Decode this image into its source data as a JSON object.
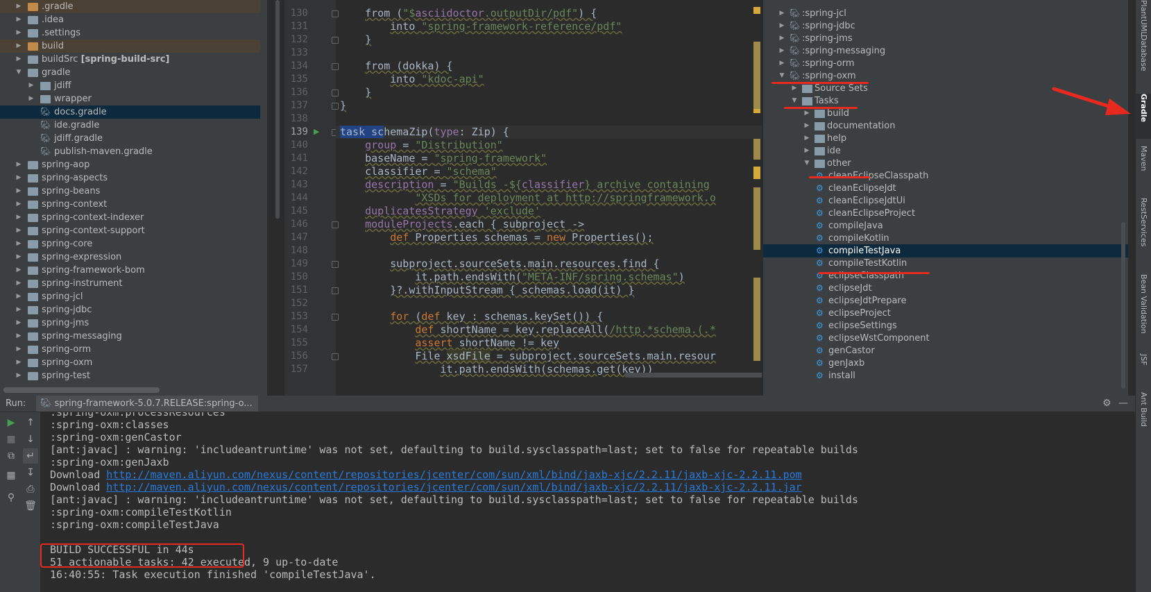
{
  "project_tree": [
    {
      "label": "gradle-dot",
      "text": ".gradle",
      "indent": 0,
      "expanded": false,
      "icon": "folder",
      "orange": true,
      "hl": true
    },
    {
      "text": ".idea",
      "indent": 0,
      "expanded": false,
      "icon": "folder"
    },
    {
      "text": ".settings",
      "indent": 0,
      "expanded": false,
      "icon": "folder"
    },
    {
      "text": "build",
      "indent": 0,
      "expanded": false,
      "icon": "folder",
      "orange": true,
      "hl": true
    },
    {
      "text": "buildSrc",
      "bold": "[spring-build-src]",
      "indent": 0,
      "expanded": false,
      "icon": "folder"
    },
    {
      "text": "gradle",
      "indent": 0,
      "expanded": true,
      "icon": "folder"
    },
    {
      "text": "jdiff",
      "indent": 1,
      "expanded": false,
      "icon": "folder"
    },
    {
      "text": "wrapper",
      "indent": 1,
      "expanded": false,
      "icon": "folder"
    },
    {
      "text": "docs.gradle",
      "indent": 1,
      "icon": "gradle-file",
      "selected": true
    },
    {
      "text": "ide.gradle",
      "indent": 1,
      "icon": "gradle-file"
    },
    {
      "text": "jdiff.gradle",
      "indent": 1,
      "icon": "gradle-file"
    },
    {
      "text": "publish-maven.gradle",
      "indent": 1,
      "icon": "gradle-file"
    },
    {
      "text": "spring-aop",
      "indent": 0,
      "expanded": false,
      "icon": "folder"
    },
    {
      "text": "spring-aspects",
      "indent": 0,
      "expanded": false,
      "icon": "folder"
    },
    {
      "text": "spring-beans",
      "indent": 0,
      "expanded": false,
      "icon": "folder"
    },
    {
      "text": "spring-context",
      "indent": 0,
      "expanded": false,
      "icon": "folder"
    },
    {
      "text": "spring-context-indexer",
      "indent": 0,
      "expanded": false,
      "icon": "folder"
    },
    {
      "text": "spring-context-support",
      "indent": 0,
      "expanded": false,
      "icon": "folder"
    },
    {
      "text": "spring-core",
      "indent": 0,
      "expanded": false,
      "icon": "folder"
    },
    {
      "text": "spring-expression",
      "indent": 0,
      "expanded": false,
      "icon": "folder"
    },
    {
      "text": "spring-framework-bom",
      "indent": 0,
      "expanded": false,
      "icon": "folder"
    },
    {
      "text": "spring-instrument",
      "indent": 0,
      "expanded": false,
      "icon": "folder"
    },
    {
      "text": "spring-jcl",
      "indent": 0,
      "expanded": false,
      "icon": "folder"
    },
    {
      "text": "spring-jdbc",
      "indent": 0,
      "expanded": false,
      "icon": "folder"
    },
    {
      "text": "spring-jms",
      "indent": 0,
      "expanded": false,
      "icon": "folder"
    },
    {
      "text": "spring-messaging",
      "indent": 0,
      "expanded": false,
      "icon": "folder"
    },
    {
      "text": "spring-orm",
      "indent": 0,
      "expanded": false,
      "icon": "folder"
    },
    {
      "text": "spring-oxm",
      "indent": 0,
      "expanded": false,
      "icon": "folder"
    },
    {
      "text": "spring-test",
      "indent": 0,
      "expanded": false,
      "icon": "folder"
    }
  ],
  "editor": {
    "line_numbers": [
      "130",
      "131",
      "132",
      "133",
      "134",
      "135",
      "136",
      "137",
      "138",
      "139",
      "140",
      "141",
      "142",
      "143",
      "144",
      "145",
      "146",
      "147",
      "148",
      "149",
      "150",
      "151",
      "152",
      "153",
      "154",
      "155",
      "156",
      "157"
    ],
    "current_line": "139"
  },
  "gradle_tree": [
    {
      "text": ":spring-jcl",
      "indent": 0,
      "expanded": false,
      "icon": "elephant"
    },
    {
      "text": ":spring-jdbc",
      "indent": 0,
      "expanded": false,
      "icon": "elephant"
    },
    {
      "text": ":spring-jms",
      "indent": 0,
      "expanded": false,
      "icon": "elephant"
    },
    {
      "text": ":spring-messaging",
      "indent": 0,
      "expanded": false,
      "icon": "elephant"
    },
    {
      "text": ":spring-orm",
      "indent": 0,
      "expanded": false,
      "icon": "elephant"
    },
    {
      "text": ":spring-oxm",
      "indent": 0,
      "expanded": true,
      "icon": "elephant"
    },
    {
      "text": "Source Sets",
      "indent": 1,
      "expanded": false,
      "icon": "folder"
    },
    {
      "text": "Tasks",
      "indent": 1,
      "expanded": true,
      "icon": "folder"
    },
    {
      "text": "build",
      "indent": 2,
      "expanded": false,
      "icon": "folder"
    },
    {
      "text": "documentation",
      "indent": 2,
      "expanded": false,
      "icon": "folder"
    },
    {
      "text": "help",
      "indent": 2,
      "expanded": false,
      "icon": "folder"
    },
    {
      "text": "ide",
      "indent": 2,
      "expanded": false,
      "icon": "folder"
    },
    {
      "text": "other",
      "indent": 2,
      "expanded": true,
      "icon": "folder"
    },
    {
      "text": "cleanEclipseClasspath",
      "indent": 3,
      "icon": "gear"
    },
    {
      "text": "cleanEclipseJdt",
      "indent": 3,
      "icon": "gear"
    },
    {
      "text": "cleanEclipseJdtUi",
      "indent": 3,
      "icon": "gear"
    },
    {
      "text": "cleanEclipseProject",
      "indent": 3,
      "icon": "gear"
    },
    {
      "text": "compileJava",
      "indent": 3,
      "icon": "gear"
    },
    {
      "text": "compileKotlin",
      "indent": 3,
      "icon": "gear"
    },
    {
      "text": "compileTestJava",
      "indent": 3,
      "icon": "gear",
      "selected": true
    },
    {
      "text": "compileTestKotlin",
      "indent": 3,
      "icon": "gear"
    },
    {
      "text": "eclipseClasspath",
      "indent": 3,
      "icon": "gear"
    },
    {
      "text": "eclipseJdt",
      "indent": 3,
      "icon": "gear"
    },
    {
      "text": "eclipseJdtPrepare",
      "indent": 3,
      "icon": "gear"
    },
    {
      "text": "eclipseProject",
      "indent": 3,
      "icon": "gear"
    },
    {
      "text": "eclipseSettings",
      "indent": 3,
      "icon": "gear"
    },
    {
      "text": "eclipseWstComponent",
      "indent": 3,
      "icon": "gear"
    },
    {
      "text": "genCastor",
      "indent": 3,
      "icon": "gear"
    },
    {
      "text": "genJaxb",
      "indent": 3,
      "icon": "gear"
    },
    {
      "text": "install",
      "indent": 3,
      "icon": "gear"
    }
  ],
  "right_tabs": [
    {
      "text": "PlantUML"
    },
    {
      "text": "Database"
    },
    {
      "text": "Gradle",
      "active": true
    },
    {
      "text": "Maven"
    },
    {
      "text": "RestServices"
    },
    {
      "text": "Bean Validation"
    },
    {
      "text": "JSF"
    },
    {
      "text": "Ant Build"
    }
  ],
  "run": {
    "label": "Run:",
    "tab_title": "spring-framework-5.0.7.RELEASE:spring-o...",
    "console": [
      {
        "text": ":spring-oxm:processResources"
      },
      {
        "text": ":spring-oxm:classes"
      },
      {
        "text": ":spring-oxm:genCastor"
      },
      {
        "text": "[ant:javac] : warning: 'includeantruntime' was not set, defaulting to build.sysclasspath=last; set to false for repeatable builds"
      },
      {
        "text": ":spring-oxm:genJaxb"
      },
      {
        "prefix": "Download ",
        "link": "http://maven.aliyun.com/nexus/content/repositories/jcenter/com/sun/xml/bind/jaxb-xjc/2.2.11/jaxb-xjc-2.2.11.pom"
      },
      {
        "prefix": "Download ",
        "link": "http://maven.aliyun.com/nexus/content/repositories/jcenter/com/sun/xml/bind/jaxb-xjc/2.2.11/jaxb-xjc-2.2.11.jar"
      },
      {
        "text": "[ant:javac] : warning: 'includeantruntime' was not set, defaulting to build.sysclasspath=last; set to false for repeatable builds"
      },
      {
        "text": ":spring-oxm:compileTestKotlin"
      },
      {
        "text": ":spring-oxm:compileTestJava"
      },
      {
        "text": ""
      },
      {
        "text": "BUILD SUCCESSFUL in 44s"
      },
      {
        "text": "51 actionable tasks: 42 executed, 9 up-to-date"
      },
      {
        "text": "16:40:55: Task execution finished 'compileTestJava'."
      }
    ]
  },
  "colors": {
    "accent_red": "#e8291f",
    "selection": "#0d293e",
    "link": "#287bde"
  }
}
